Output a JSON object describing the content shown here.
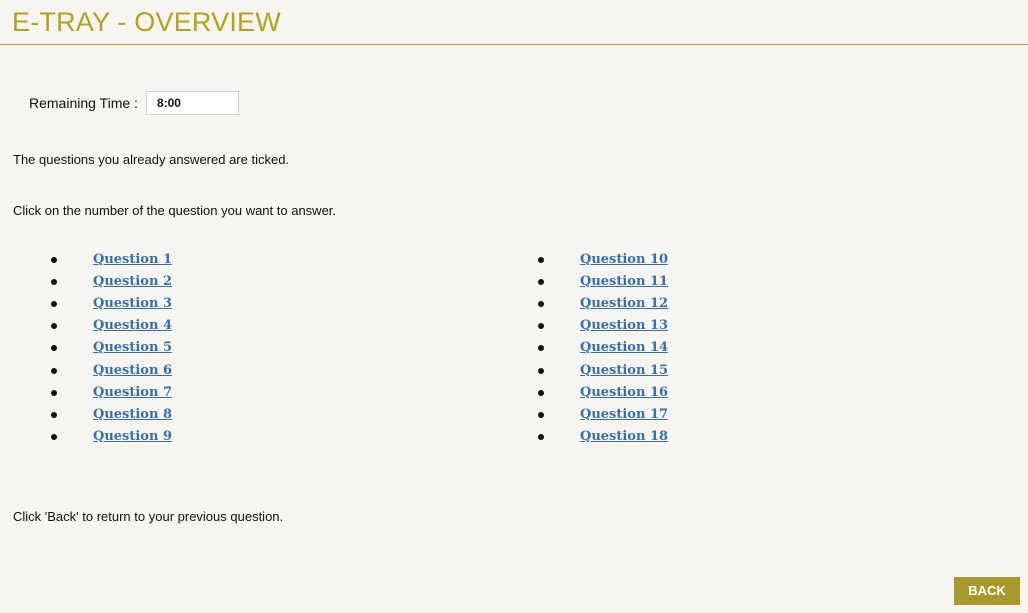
{
  "header": {
    "title": "E-TRAY - OVERVIEW"
  },
  "timer": {
    "label": "Remaining Time :",
    "value": "8:00"
  },
  "instructions": {
    "answered": "The questions you already answered are ticked.",
    "click": "Click on the number of the question you want to answer.",
    "back": "Click 'Back' to return to your previous question."
  },
  "questions": [
    "Question 1",
    "Question 2",
    "Question 3",
    "Question 4",
    "Question 5",
    "Question 6",
    "Question 7",
    "Question 8",
    "Question 9",
    "Question 10",
    "Question 11",
    "Question 12",
    "Question 13",
    "Question 14",
    "Question 15",
    "Question 16",
    "Question 17",
    "Question 18"
  ],
  "buttons": {
    "back": "BACK"
  },
  "colors": {
    "accent": "#b3a21f",
    "button": "#a7992b",
    "link": "#3a6fa6",
    "background": "#f6f5f2"
  }
}
